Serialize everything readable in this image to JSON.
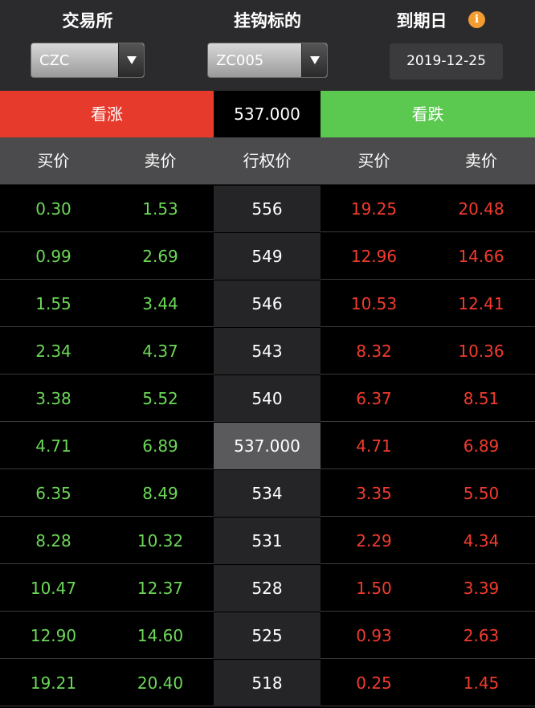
{
  "top": {
    "exchange_label": "交易所",
    "exchange_value": "CZC",
    "underlying_label": "挂钩标的",
    "underlying_value": "ZC005",
    "expiry_label": "到期日",
    "expiry_value": "2019-12-25",
    "info_icon": "i"
  },
  "bar": {
    "call_label": "看涨",
    "spot_price": "537.000",
    "put_label": "看跌"
  },
  "header": {
    "call_bid": "买价",
    "call_ask": "卖价",
    "strike": "行权价",
    "put_bid": "买价",
    "put_ask": "卖价"
  },
  "colors": {
    "call": "#e63a2c",
    "put": "#5bc94f",
    "green_text": "#6cd858",
    "red_text": "#f23b2e"
  },
  "rows": [
    {
      "call_bid": "0.30",
      "call_ask": "1.53",
      "strike": "556",
      "put_bid": "19.25",
      "put_ask": "20.48"
    },
    {
      "call_bid": "0.99",
      "call_ask": "2.69",
      "strike": "549",
      "put_bid": "12.96",
      "put_ask": "14.66"
    },
    {
      "call_bid": "1.55",
      "call_ask": "3.44",
      "strike": "546",
      "put_bid": "10.53",
      "put_ask": "12.41"
    },
    {
      "call_bid": "2.34",
      "call_ask": "4.37",
      "strike": "543",
      "put_bid": "8.32",
      "put_ask": "10.36"
    },
    {
      "call_bid": "3.38",
      "call_ask": "5.52",
      "strike": "540",
      "put_bid": "6.37",
      "put_ask": "8.51"
    },
    {
      "call_bid": "4.71",
      "call_ask": "6.89",
      "strike": "537.000",
      "put_bid": "4.71",
      "put_ask": "6.89"
    },
    {
      "call_bid": "6.35",
      "call_ask": "8.49",
      "strike": "534",
      "put_bid": "3.35",
      "put_ask": "5.50"
    },
    {
      "call_bid": "8.28",
      "call_ask": "10.32",
      "strike": "531",
      "put_bid": "2.29",
      "put_ask": "4.34"
    },
    {
      "call_bid": "10.47",
      "call_ask": "12.37",
      "strike": "528",
      "put_bid": "1.50",
      "put_ask": "3.39"
    },
    {
      "call_bid": "12.90",
      "call_ask": "14.60",
      "strike": "525",
      "put_bid": "0.93",
      "put_ask": "2.63"
    },
    {
      "call_bid": "19.21",
      "call_ask": "20.40",
      "strike": "518",
      "put_bid": "0.25",
      "put_ask": "1.45"
    }
  ]
}
